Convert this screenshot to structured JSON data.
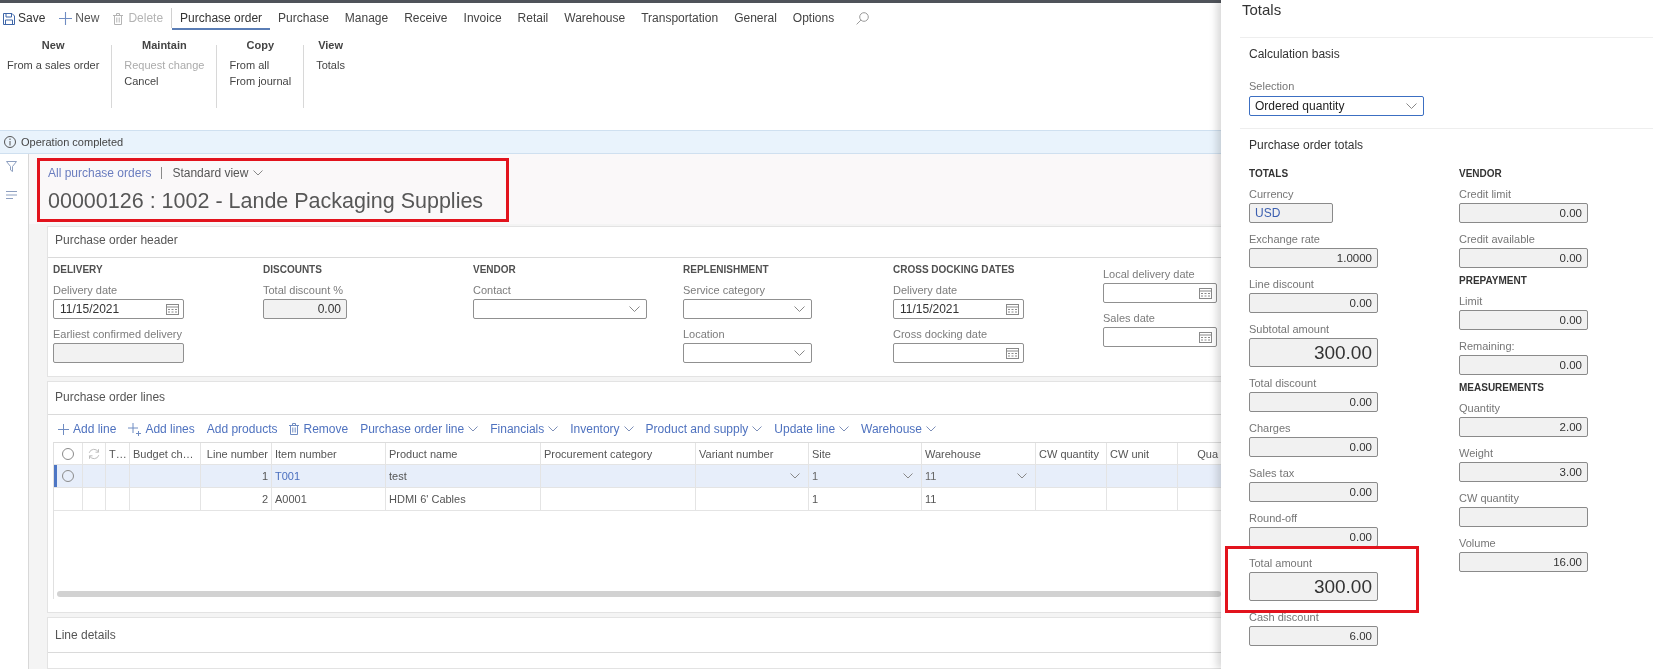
{
  "action_bar": {
    "commands": [
      {
        "kind": "save",
        "label": "Save",
        "disabled": false
      },
      {
        "kind": "new",
        "label": "New",
        "disabled": false
      },
      {
        "kind": "delete",
        "label": "Delete",
        "disabled": true
      }
    ],
    "tabs": [
      {
        "label": "Purchase order",
        "selected": true
      },
      {
        "label": "Purchase",
        "selected": false
      },
      {
        "label": "Manage",
        "selected": false
      },
      {
        "label": "Receive",
        "selected": false
      },
      {
        "label": "Invoice",
        "selected": false
      },
      {
        "label": "Retail",
        "selected": false
      },
      {
        "label": "Warehouse",
        "selected": false
      },
      {
        "label": "Transportation",
        "selected": false
      },
      {
        "label": "General",
        "selected": false
      },
      {
        "label": "Options",
        "selected": false
      }
    ]
  },
  "ribbon": {
    "groups": [
      {
        "title": "New",
        "items": [
          {
            "label": "From a sales order",
            "disabled": false
          }
        ]
      },
      {
        "title": "Maintain",
        "items": [
          {
            "label": "Request change",
            "disabled": true
          },
          {
            "label": "Cancel",
            "disabled": false
          }
        ]
      },
      {
        "title": "Copy",
        "items": [
          {
            "label": "From all",
            "disabled": false
          },
          {
            "label": "From journal",
            "disabled": false
          }
        ]
      },
      {
        "title": "View",
        "items": [
          {
            "label": "Totals",
            "disabled": false
          }
        ]
      }
    ]
  },
  "message_bar": {
    "text": "Operation completed"
  },
  "page_header": {
    "breadcrumb": "All purchase orders",
    "view": "Standard view",
    "title": "00000126 : 1002 - Lande Packaging Supplies",
    "highlighted": true
  },
  "header_card": {
    "title": "Purchase order header",
    "groups": [
      {
        "heading": "DELIVERY",
        "fields": [
          {
            "label": "Delivery date",
            "kind": "date",
            "value": "11/15/2021",
            "readonly": false
          },
          {
            "label": "Earliest confirmed delivery",
            "kind": "text",
            "readonly": true
          }
        ]
      },
      {
        "heading": "DISCOUNTS",
        "fields": [
          {
            "label": "Total discount %",
            "kind": "number",
            "value": "0.00",
            "readonly": true
          }
        ]
      },
      {
        "heading": "VENDOR",
        "fields": [
          {
            "label": "Contact",
            "kind": "select",
            "readonly": false
          }
        ]
      },
      {
        "heading": "REPLENISHMENT",
        "fields": [
          {
            "label": "Service category",
            "kind": "select",
            "readonly": false
          },
          {
            "label": "Location",
            "kind": "select",
            "readonly": false
          }
        ]
      },
      {
        "heading": "CROSS DOCKING DATES",
        "fields": [
          {
            "label": "Delivery date",
            "kind": "date",
            "value": "11/15/2021",
            "readonly": false
          },
          {
            "label": "Cross docking date",
            "kind": "date",
            "readonly": false
          }
        ]
      },
      {
        "fields": [
          {
            "label": "Local delivery date",
            "kind": "date",
            "readonly": false
          },
          {
            "label": "Sales date",
            "kind": "date",
            "readonly": false
          }
        ]
      }
    ]
  },
  "lines_card": {
    "title": "Purchase order lines",
    "toolbar": [
      {
        "kind": "add",
        "label": "Add line"
      },
      {
        "kind": "add_multiple",
        "label": "Add lines"
      },
      {
        "kind": "plain",
        "label": "Add products"
      },
      {
        "kind": "remove",
        "label": "Remove"
      },
      {
        "kind": "menu",
        "label": "Purchase order line"
      },
      {
        "kind": "menu",
        "label": "Financials"
      },
      {
        "kind": "menu",
        "label": "Inventory"
      },
      {
        "kind": "menu",
        "label": "Product and supply"
      },
      {
        "kind": "menu",
        "label": "Update line"
      },
      {
        "kind": "menu",
        "label": "Warehouse"
      }
    ],
    "table": {
      "columns": [
        {
          "kind": "select"
        },
        {
          "kind": "refresh"
        },
        {
          "kind": "text",
          "label": "T…"
        },
        {
          "kind": "text",
          "label": "Budget ch…"
        },
        {
          "kind": "number",
          "label": "Line number"
        },
        {
          "kind": "link",
          "label": "Item number"
        },
        {
          "kind": "text",
          "label": "Product name"
        },
        {
          "kind": "text",
          "label": "Procurement category"
        },
        {
          "kind": "lookup",
          "label": "Variant number"
        },
        {
          "kind": "lookup",
          "label": "Site"
        },
        {
          "kind": "lookup",
          "label": "Warehouse"
        },
        {
          "kind": "text",
          "label": "CW quantity"
        },
        {
          "kind": "text",
          "label": "CW unit"
        },
        {
          "kind": "number",
          "label": "Qua"
        }
      ],
      "rows": [
        {
          "selected": true,
          "line_number": "1",
          "item_number": "T001",
          "product_name": "test",
          "site": "1",
          "warehouse": "11"
        },
        {
          "selected": false,
          "line_number": "2",
          "item_number": "A0001",
          "product_name": "HDMI 6' Cables",
          "site": "1",
          "warehouse": "11"
        }
      ]
    }
  },
  "line_details": {
    "title": "Line details"
  },
  "totals_panel": {
    "title": "Totals",
    "calculation_basis": {
      "heading": "Calculation basis",
      "selection": {
        "label": "Selection",
        "value": "Ordered quantity"
      }
    },
    "order_totals": {
      "heading": "Purchase order totals",
      "columns": [
        {
          "sections": [
            {
              "heading": "TOTALS",
              "fields": [
                {
                  "label": "Currency",
                  "value": "USD",
                  "kind": "code",
                  "highlighted": false
                },
                {
                  "label": "Exchange rate",
                  "value": "1.0000",
                  "kind": "amount",
                  "highlighted": false
                },
                {
                  "label": "Line discount",
                  "value": "0.00",
                  "kind": "amount",
                  "highlighted": false
                },
                {
                  "label": "Subtotal amount",
                  "value": "300.00",
                  "kind": "total",
                  "highlighted": false
                },
                {
                  "label": "Total discount",
                  "value": "0.00",
                  "kind": "amount",
                  "highlighted": false
                },
                {
                  "label": "Charges",
                  "value": "0.00",
                  "kind": "amount",
                  "highlighted": false
                },
                {
                  "label": "Sales tax",
                  "value": "0.00",
                  "kind": "amount",
                  "highlighted": false
                },
                {
                  "label": "Round-off",
                  "value": "0.00",
                  "kind": "amount",
                  "highlighted": false
                },
                {
                  "label": "Total amount",
                  "value": "300.00",
                  "kind": "total",
                  "highlighted": true
                },
                {
                  "label": "Cash discount",
                  "value": "6.00",
                  "kind": "amount",
                  "highlighted": false
                }
              ]
            }
          ]
        },
        {
          "sections": [
            {
              "heading": "VENDOR",
              "fields": [
                {
                  "label": "Credit limit",
                  "value": "0.00",
                  "kind": "amount",
                  "highlighted": false
                },
                {
                  "label": "Credit available",
                  "value": "0.00",
                  "kind": "amount",
                  "highlighted": false
                }
              ]
            },
            {
              "heading": "PREPAYMENT",
              "fields": [
                {
                  "label": "Limit",
                  "value": "0.00",
                  "kind": "amount",
                  "highlighted": false
                },
                {
                  "label": "Remaining:",
                  "value": "0.00",
                  "kind": "amount",
                  "highlighted": false
                }
              ]
            },
            {
              "heading": "MEASUREMENTS",
              "fields": [
                {
                  "label": "Quantity",
                  "value": "2.00",
                  "kind": "amount",
                  "highlighted": false
                },
                {
                  "label": "Weight",
                  "value": "3.00",
                  "kind": "amount",
                  "highlighted": false
                },
                {
                  "label": "CW quantity",
                  "kind": "amount",
                  "highlighted": false
                },
                {
                  "label": "Volume",
                  "value": "16.00",
                  "kind": "amount",
                  "highlighted": false
                }
              ]
            }
          ]
        }
      ]
    }
  }
}
